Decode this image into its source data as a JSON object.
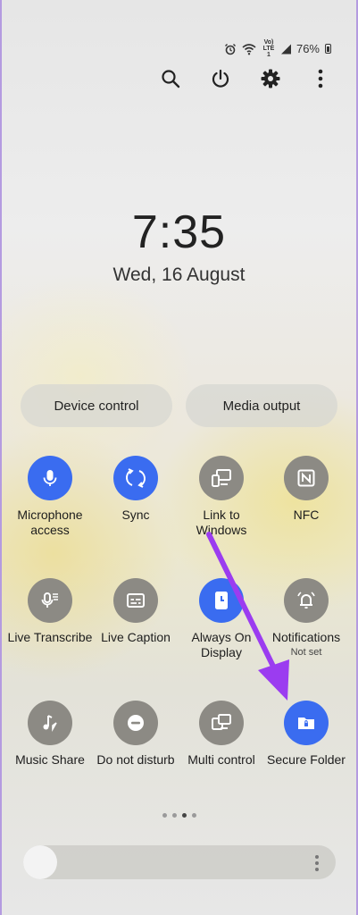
{
  "status": {
    "battery": "76%",
    "network": "Vo) LTE1"
  },
  "clock": {
    "time": "7:35",
    "date": "Wed, 16 August"
  },
  "quick_buttons": {
    "device_control": "Device control",
    "media_output": "Media output"
  },
  "tiles": [
    {
      "label": "Microphone access",
      "state": "on",
      "icon": "microphone-icon"
    },
    {
      "label": "Sync",
      "state": "on",
      "icon": "sync-icon"
    },
    {
      "label": "Link to Windows",
      "state": "off",
      "icon": "link-to-windows-icon"
    },
    {
      "label": "NFC",
      "state": "off",
      "icon": "nfc-icon"
    },
    {
      "label": "Live Transcribe",
      "state": "off",
      "icon": "live-transcribe-icon"
    },
    {
      "label": "Live Caption",
      "state": "off",
      "icon": "live-caption-icon"
    },
    {
      "label": "Always On Display",
      "state": "on",
      "icon": "always-on-display-icon"
    },
    {
      "label": "Notifications",
      "sublabel": "Not set",
      "state": "off",
      "icon": "notifications-icon"
    },
    {
      "label": "Music Share",
      "state": "off",
      "icon": "music-share-icon"
    },
    {
      "label": "Do not disturb",
      "state": "off",
      "icon": "do-not-disturb-icon"
    },
    {
      "label": "Multi control",
      "state": "off",
      "icon": "multi-control-icon"
    },
    {
      "label": "Secure Folder",
      "state": "on",
      "icon": "secure-folder-icon"
    }
  ],
  "page_indicator": {
    "total": 4,
    "active": 2
  },
  "brightness": {
    "level": 0.05
  },
  "colors": {
    "accent": "#3a6cf0",
    "tile_off": "#8c8a84",
    "arrow": "#9b3cf0"
  }
}
